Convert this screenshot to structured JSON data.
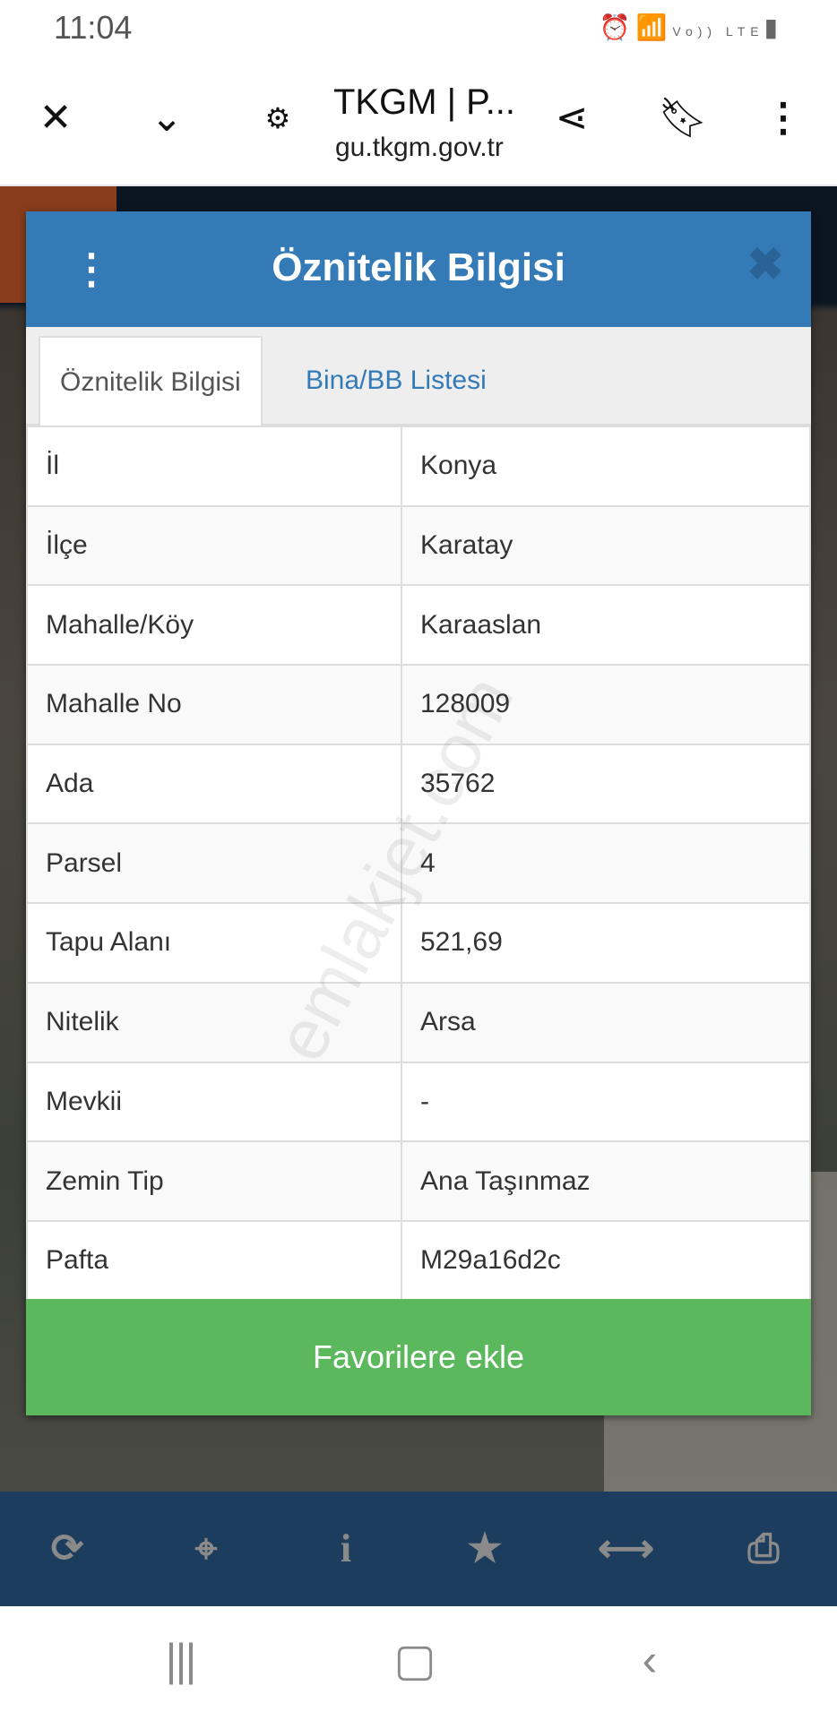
{
  "status_bar": {
    "time": "11:04",
    "icons": [
      "alarm-icon",
      "wifi-icon",
      "volte-icon",
      "signal-icon",
      "battery-icon"
    ],
    "volte_label": "Vo)) LTE"
  },
  "browser": {
    "title": "TKGM | P...",
    "url": "gu.tkgm.gov.tr"
  },
  "modal": {
    "title": "Öznitelik Bilgisi",
    "tabs": [
      {
        "label": "Öznitelik Bilgisi",
        "active": true
      },
      {
        "label": "Bina/BB Listesi",
        "active": false
      }
    ],
    "rows": [
      {
        "key": "İl",
        "value": "Konya"
      },
      {
        "key": "İlçe",
        "value": "Karatay"
      },
      {
        "key": "Mahalle/Köy",
        "value": "Karaaslan"
      },
      {
        "key": "Mahalle No",
        "value": "128009"
      },
      {
        "key": "Ada",
        "value": "35762"
      },
      {
        "key": "Parsel",
        "value": "4"
      },
      {
        "key": "Tapu Alanı",
        "value": "521,69"
      },
      {
        "key": "Nitelik",
        "value": "Arsa"
      },
      {
        "key": "Mevkii",
        "value": "-"
      },
      {
        "key": "Zemin Tip",
        "value": "Ana Taşınmaz"
      },
      {
        "key": "Pafta",
        "value": "M29a16d2c"
      }
    ],
    "favorite_button": "Favorilere ekle"
  },
  "watermark": "emlakjet.com",
  "toolbar": [
    "refresh-icon",
    "crosshair-icon",
    "info-icon",
    "star-icon",
    "measure-icon",
    "print-icon"
  ],
  "colors": {
    "header": "#337ab7",
    "favorite": "#5cb85c",
    "toolbar": "#1c3d5e"
  }
}
